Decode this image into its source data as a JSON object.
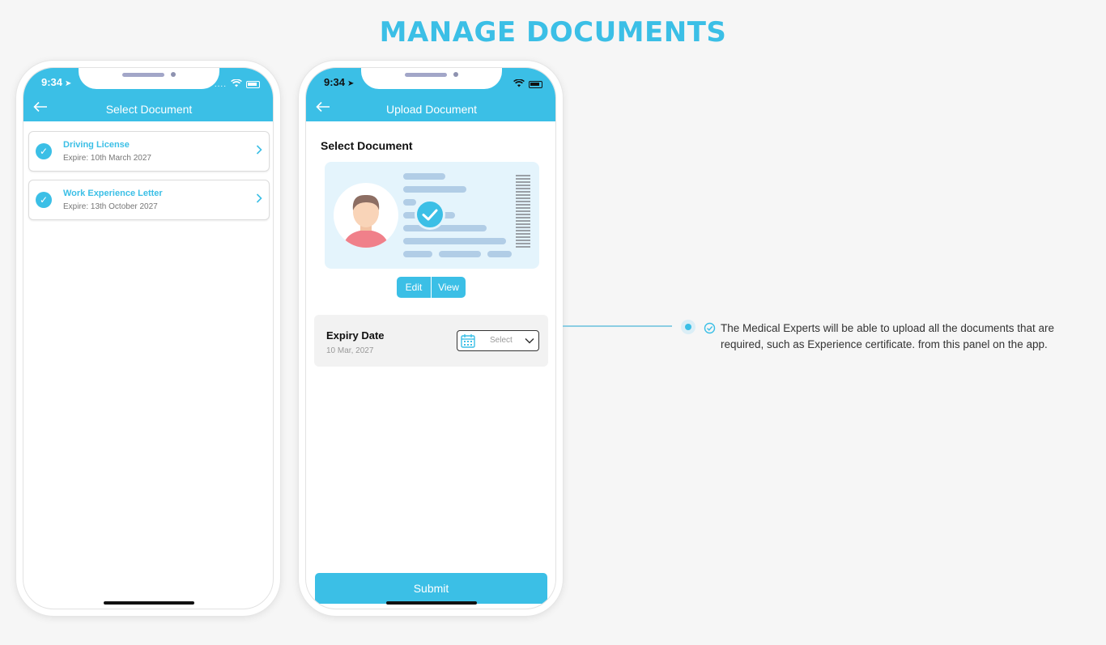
{
  "page": {
    "title": "MANAGE DOCUMENTS",
    "accent_color": "#3bbfe6"
  },
  "phone_left": {
    "status": {
      "time": "9:34",
      "signal": "...."
    },
    "header": {
      "title": "Select Document",
      "back_icon": "arrow-left-icon"
    },
    "documents": [
      {
        "name": "Driving License",
        "expire": "Expire: 10th March 2027"
      },
      {
        "name": "Work Experience Letter",
        "expire": "Expire: 13th October 2027"
      }
    ]
  },
  "phone_right": {
    "status": {
      "time": "9:34"
    },
    "header": {
      "title": "Upload Document",
      "back_icon": "arrow-left-icon"
    },
    "section_label": "Select Document",
    "card_actions": {
      "edit": "Edit",
      "view": "View"
    },
    "expiry": {
      "label": "Expiry Date",
      "date": "10 Mar, 2027",
      "select_placeholder": "Select"
    },
    "submit_label": "Submit"
  },
  "feature": {
    "text": "The Medical Experts will be able to upload all the documents that are required, such as Experience certificate. from this panel on the app."
  }
}
